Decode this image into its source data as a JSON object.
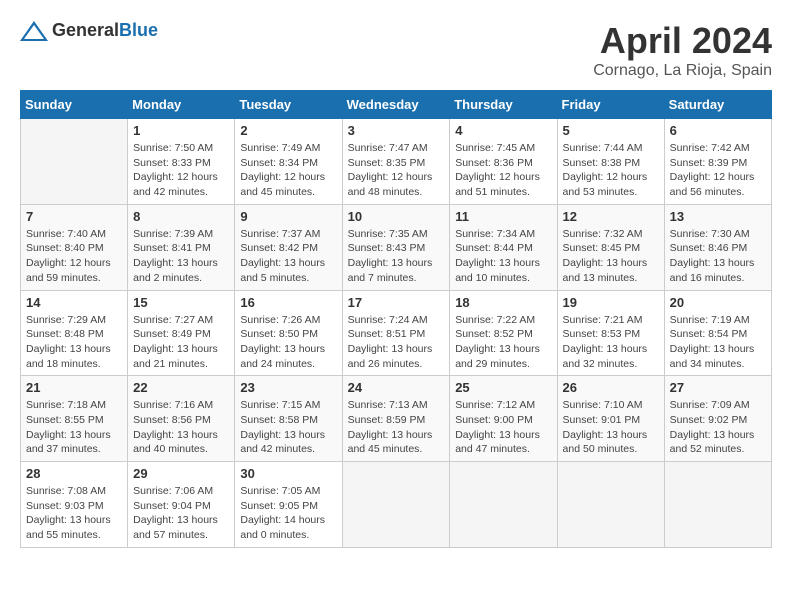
{
  "header": {
    "logo_general": "General",
    "logo_blue": "Blue",
    "month_title": "April 2024",
    "location": "Cornago, La Rioja, Spain"
  },
  "weekdays": [
    "Sunday",
    "Monday",
    "Tuesday",
    "Wednesday",
    "Thursday",
    "Friday",
    "Saturday"
  ],
  "weeks": [
    [
      {
        "day": "",
        "info": ""
      },
      {
        "day": "1",
        "info": "Sunrise: 7:50 AM\nSunset: 8:33 PM\nDaylight: 12 hours\nand 42 minutes."
      },
      {
        "day": "2",
        "info": "Sunrise: 7:49 AM\nSunset: 8:34 PM\nDaylight: 12 hours\nand 45 minutes."
      },
      {
        "day": "3",
        "info": "Sunrise: 7:47 AM\nSunset: 8:35 PM\nDaylight: 12 hours\nand 48 minutes."
      },
      {
        "day": "4",
        "info": "Sunrise: 7:45 AM\nSunset: 8:36 PM\nDaylight: 12 hours\nand 51 minutes."
      },
      {
        "day": "5",
        "info": "Sunrise: 7:44 AM\nSunset: 8:38 PM\nDaylight: 12 hours\nand 53 minutes."
      },
      {
        "day": "6",
        "info": "Sunrise: 7:42 AM\nSunset: 8:39 PM\nDaylight: 12 hours\nand 56 minutes."
      }
    ],
    [
      {
        "day": "7",
        "info": "Sunrise: 7:40 AM\nSunset: 8:40 PM\nDaylight: 12 hours\nand 59 minutes."
      },
      {
        "day": "8",
        "info": "Sunrise: 7:39 AM\nSunset: 8:41 PM\nDaylight: 13 hours\nand 2 minutes."
      },
      {
        "day": "9",
        "info": "Sunrise: 7:37 AM\nSunset: 8:42 PM\nDaylight: 13 hours\nand 5 minutes."
      },
      {
        "day": "10",
        "info": "Sunrise: 7:35 AM\nSunset: 8:43 PM\nDaylight: 13 hours\nand 7 minutes."
      },
      {
        "day": "11",
        "info": "Sunrise: 7:34 AM\nSunset: 8:44 PM\nDaylight: 13 hours\nand 10 minutes."
      },
      {
        "day": "12",
        "info": "Sunrise: 7:32 AM\nSunset: 8:45 PM\nDaylight: 13 hours\nand 13 minutes."
      },
      {
        "day": "13",
        "info": "Sunrise: 7:30 AM\nSunset: 8:46 PM\nDaylight: 13 hours\nand 16 minutes."
      }
    ],
    [
      {
        "day": "14",
        "info": "Sunrise: 7:29 AM\nSunset: 8:48 PM\nDaylight: 13 hours\nand 18 minutes."
      },
      {
        "day": "15",
        "info": "Sunrise: 7:27 AM\nSunset: 8:49 PM\nDaylight: 13 hours\nand 21 minutes."
      },
      {
        "day": "16",
        "info": "Sunrise: 7:26 AM\nSunset: 8:50 PM\nDaylight: 13 hours\nand 24 minutes."
      },
      {
        "day": "17",
        "info": "Sunrise: 7:24 AM\nSunset: 8:51 PM\nDaylight: 13 hours\nand 26 minutes."
      },
      {
        "day": "18",
        "info": "Sunrise: 7:22 AM\nSunset: 8:52 PM\nDaylight: 13 hours\nand 29 minutes."
      },
      {
        "day": "19",
        "info": "Sunrise: 7:21 AM\nSunset: 8:53 PM\nDaylight: 13 hours\nand 32 minutes."
      },
      {
        "day": "20",
        "info": "Sunrise: 7:19 AM\nSunset: 8:54 PM\nDaylight: 13 hours\nand 34 minutes."
      }
    ],
    [
      {
        "day": "21",
        "info": "Sunrise: 7:18 AM\nSunset: 8:55 PM\nDaylight: 13 hours\nand 37 minutes."
      },
      {
        "day": "22",
        "info": "Sunrise: 7:16 AM\nSunset: 8:56 PM\nDaylight: 13 hours\nand 40 minutes."
      },
      {
        "day": "23",
        "info": "Sunrise: 7:15 AM\nSunset: 8:58 PM\nDaylight: 13 hours\nand 42 minutes."
      },
      {
        "day": "24",
        "info": "Sunrise: 7:13 AM\nSunset: 8:59 PM\nDaylight: 13 hours\nand 45 minutes."
      },
      {
        "day": "25",
        "info": "Sunrise: 7:12 AM\nSunset: 9:00 PM\nDaylight: 13 hours\nand 47 minutes."
      },
      {
        "day": "26",
        "info": "Sunrise: 7:10 AM\nSunset: 9:01 PM\nDaylight: 13 hours\nand 50 minutes."
      },
      {
        "day": "27",
        "info": "Sunrise: 7:09 AM\nSunset: 9:02 PM\nDaylight: 13 hours\nand 52 minutes."
      }
    ],
    [
      {
        "day": "28",
        "info": "Sunrise: 7:08 AM\nSunset: 9:03 PM\nDaylight: 13 hours\nand 55 minutes."
      },
      {
        "day": "29",
        "info": "Sunrise: 7:06 AM\nSunset: 9:04 PM\nDaylight: 13 hours\nand 57 minutes."
      },
      {
        "day": "30",
        "info": "Sunrise: 7:05 AM\nSunset: 9:05 PM\nDaylight: 14 hours\nand 0 minutes."
      },
      {
        "day": "",
        "info": ""
      },
      {
        "day": "",
        "info": ""
      },
      {
        "day": "",
        "info": ""
      },
      {
        "day": "",
        "info": ""
      }
    ]
  ]
}
